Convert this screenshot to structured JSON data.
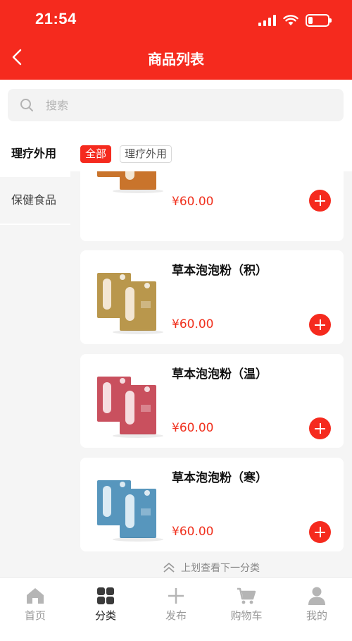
{
  "status_bar": {
    "time": "21:54"
  },
  "header": {
    "title": "商品列表"
  },
  "search": {
    "placeholder": "搜索"
  },
  "sidebar": {
    "items": [
      {
        "label": "理疗外用",
        "active": true
      },
      {
        "label": "保健食品",
        "active": false
      }
    ]
  },
  "filters": {
    "all_label": "全部",
    "category_label": "理疗外用"
  },
  "products": [
    {
      "name": "",
      "price": "¥60.00",
      "box_color": "#c9742c"
    },
    {
      "name": "草本泡泡粉（积）",
      "price": "¥60.00",
      "box_color": "#b9974c"
    },
    {
      "name": "草本泡泡粉（温）",
      "price": "¥60.00",
      "box_color": "#c9505e"
    },
    {
      "name": "草本泡泡粉（寒）",
      "price": "¥60.00",
      "box_color": "#5796bd"
    }
  ],
  "scroll_hint": "上划查看下一分类",
  "tabbar": {
    "tabs": [
      {
        "label": "首页",
        "icon": "home-icon",
        "active": false
      },
      {
        "label": "分类",
        "icon": "category-grid-icon",
        "active": true
      },
      {
        "label": "发布",
        "icon": "plus-icon",
        "active": false
      },
      {
        "label": "购物车",
        "icon": "cart-icon",
        "active": false
      },
      {
        "label": "我的",
        "icon": "user-icon",
        "active": false
      }
    ]
  },
  "colors": {
    "brand": "#f52a1e",
    "price": "#f0321f"
  }
}
